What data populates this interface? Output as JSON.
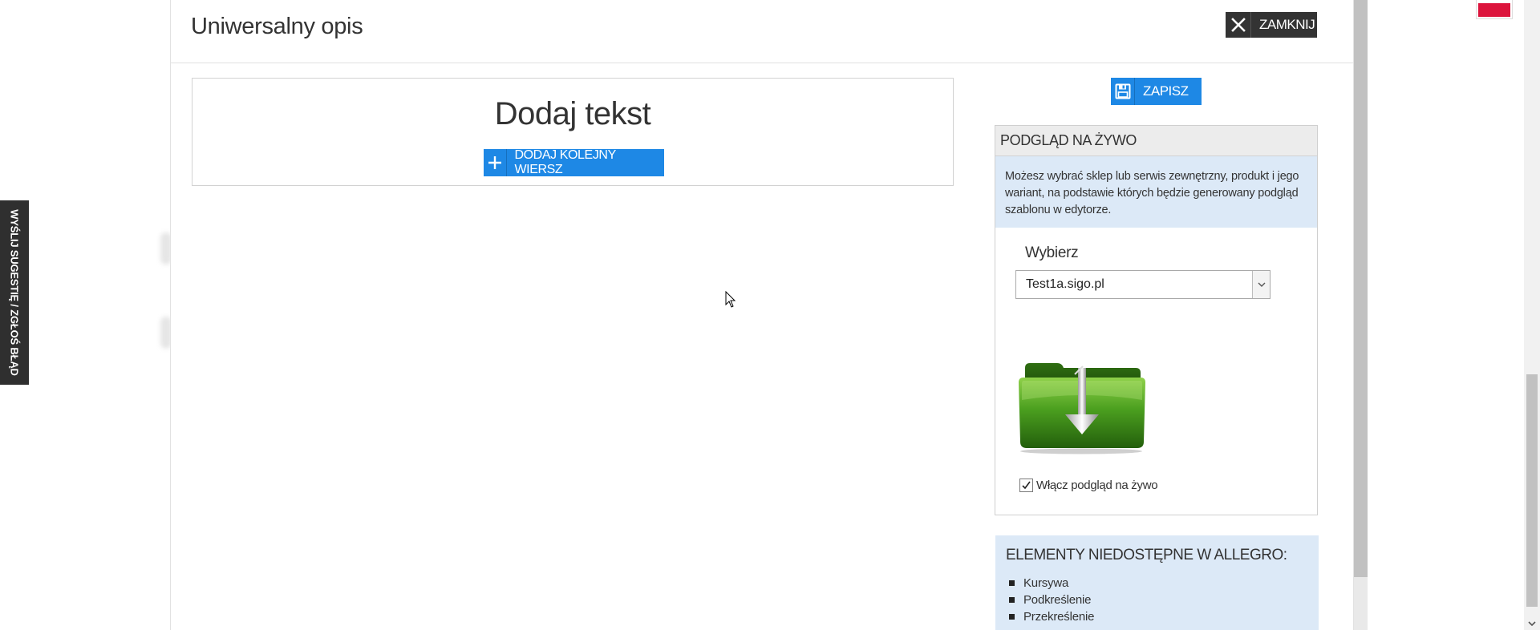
{
  "feedback": {
    "label": "WYŚLIJ SUGESTIĘ / ZGŁOŚ BŁĄD"
  },
  "modal": {
    "title": "Uniwersalny opis",
    "close_label": "ZAMKNIJ"
  },
  "editor": {
    "heading": "Dodaj tekst",
    "add_row_label": "DODAJ KOLEJNY WIERSZ"
  },
  "toolbar": {
    "save_label": "ZAPISZ"
  },
  "preview": {
    "header": "PODGLĄD NA ŻYWO",
    "info": "Możesz wybrać sklep lub serwis zewnętrzny, produkt i jego wariant, na podstawie których będzie generowany podgląd szablonu w edytorze.",
    "select_label": "Wybierz",
    "selected_value": "Test1a.sigo.pl",
    "live_toggle_label": "Włącz podgląd na żywo",
    "live_toggle_checked": true
  },
  "unavailable": {
    "title": "ELEMENTY NIEDOSTĘPNE W ALLEGRO:",
    "items": [
      "Kursywa",
      "Podkreślenie",
      "Przekreślenie"
    ]
  },
  "colors": {
    "accent": "#1e88e5",
    "dark_button": "#333333",
    "info_bg": "#dce9f7",
    "folder_green": "#3e8f1c"
  },
  "icons": {
    "close": "close-icon",
    "plus": "plus-icon",
    "save": "floppy-disk-icon",
    "folder": "green-download-folder-icon"
  }
}
